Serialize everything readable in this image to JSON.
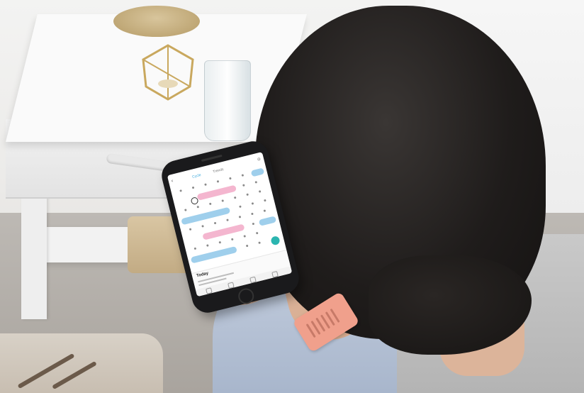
{
  "scene": {
    "description_key": "photo",
    "accent_pink": "#f4b6cf",
    "accent_blue": "#9fcfec",
    "watch_band_color": "#f0a08c"
  },
  "phone_app": {
    "header": {
      "back_icon": "chevron-left-icon",
      "tab_cycle": "Cycle",
      "tab_trends": "Trends",
      "settings_icon": "gear-icon"
    },
    "today_panel": {
      "title": "Today"
    }
  }
}
